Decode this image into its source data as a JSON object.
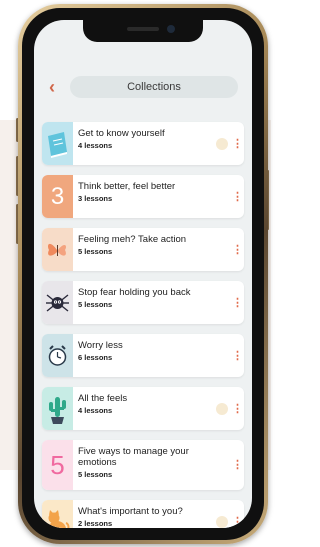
{
  "header": {
    "title": "Collections",
    "back_icon": "chevron-left-icon"
  },
  "colors": {
    "accent": "#d0674a",
    "screen_bg": "#eef1f2"
  },
  "collections": [
    {
      "title": "Get to know yourself",
      "subtitle": "4 lessons",
      "thumb_color": "#bfe5ef",
      "thumb_icon": "book-icon",
      "in_progress": true
    },
    {
      "title": "Think better, feel better",
      "subtitle": "3 lessons",
      "thumb_color": "#f0a77e",
      "thumb_glyph": "3",
      "in_progress": false
    },
    {
      "title": "Feeling meh? Take action",
      "subtitle": "5 lessons",
      "thumb_color": "#f7dcc8",
      "thumb_icon": "butterfly-icon",
      "in_progress": false
    },
    {
      "title": "Stop fear holding you back",
      "subtitle": "5 lessons",
      "thumb_color": "#e8e6ea",
      "thumb_icon": "spider-icon",
      "in_progress": false
    },
    {
      "title": "Worry less",
      "subtitle": "6 lessons",
      "thumb_color": "#cde3e8",
      "thumb_icon": "alarm-clock-icon",
      "in_progress": false
    },
    {
      "title": "All the feels",
      "subtitle": "4 lessons",
      "thumb_color": "#c7ece5",
      "thumb_icon": "cactus-icon",
      "in_progress": true
    },
    {
      "title": "Five ways to manage your emotions",
      "subtitle": "5 lessons",
      "thumb_color": "#fbe0ea",
      "thumb_glyph": "5",
      "in_progress": false
    },
    {
      "title": "What's important to you?",
      "subtitle": "2 lessons",
      "thumb_color": "#fbe8c8",
      "thumb_icon": "cat-icon",
      "in_progress": true
    }
  ]
}
